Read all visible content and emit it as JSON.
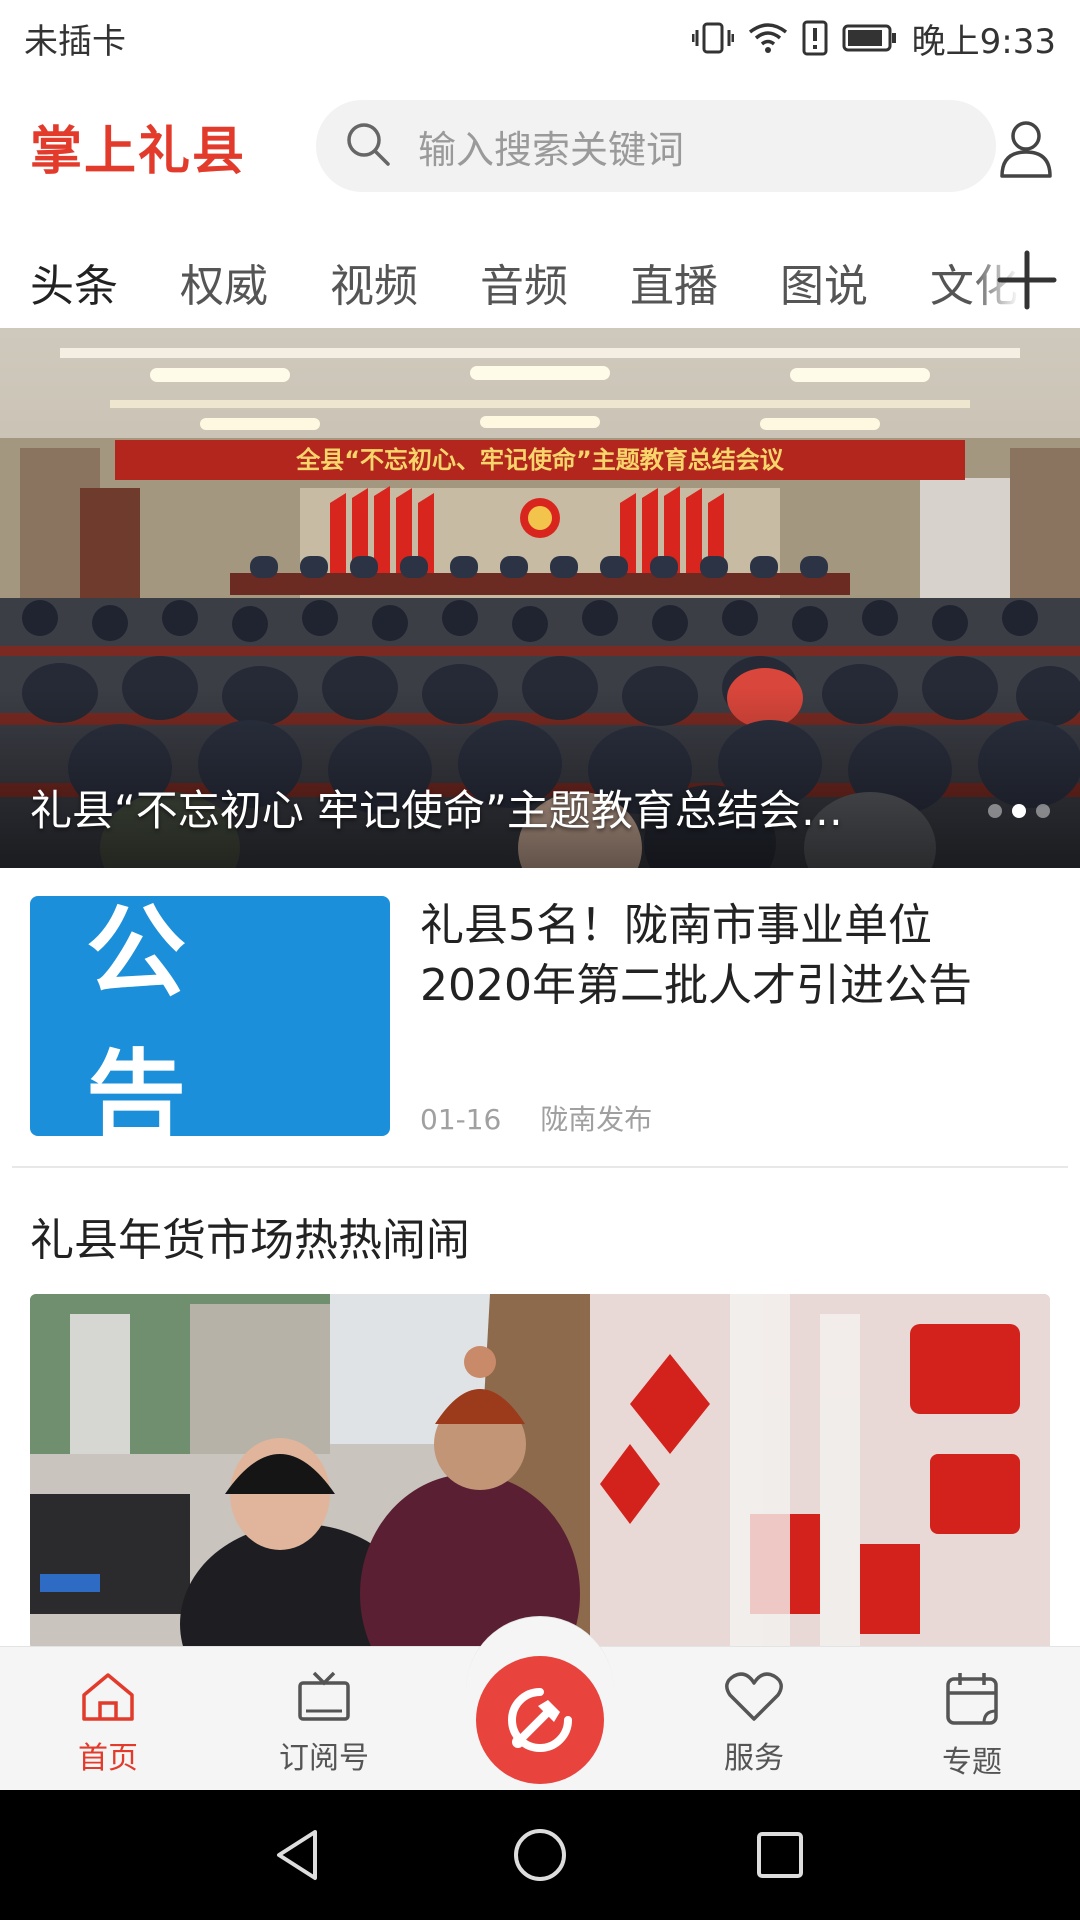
{
  "status_bar": {
    "carrier": "未插卡",
    "time": "晚上9:33"
  },
  "header": {
    "app_name": "掌上礼县",
    "search_placeholder": "输入搜索关键词"
  },
  "tabs": [
    "头条",
    "权威",
    "视频",
    "音频",
    "直播",
    "图说",
    "文化"
  ],
  "banner": {
    "banner_text": "全县“不忘初心、牢记使命”主题教育总结会议",
    "caption": "礼县“不忘初心 牢记使命”主题教育总结会…",
    "slide_count": 3,
    "active_slide": 2
  },
  "news_item": {
    "thumb_text": "公告",
    "title": "礼县5名！陇南市事业单位2020年第二批人才引进公告",
    "date": "01-16",
    "source": "陇南发布"
  },
  "feature": {
    "title": "礼县年货市场热热闹闹"
  },
  "bottom_nav": [
    {
      "label": "首页",
      "icon": "home-icon",
      "active": true
    },
    {
      "label": "订阅号",
      "icon": "tv-icon",
      "active": false
    },
    {
      "label": "",
      "icon": "party-emblem-icon",
      "active": false
    },
    {
      "label": "服务",
      "icon": "heart-icon",
      "active": false
    },
    {
      "label": "专题",
      "icon": "calendar-icon",
      "active": false
    }
  ],
  "colors": {
    "accent": "#e23b2c",
    "notice_blue": "#1b8fd9"
  }
}
